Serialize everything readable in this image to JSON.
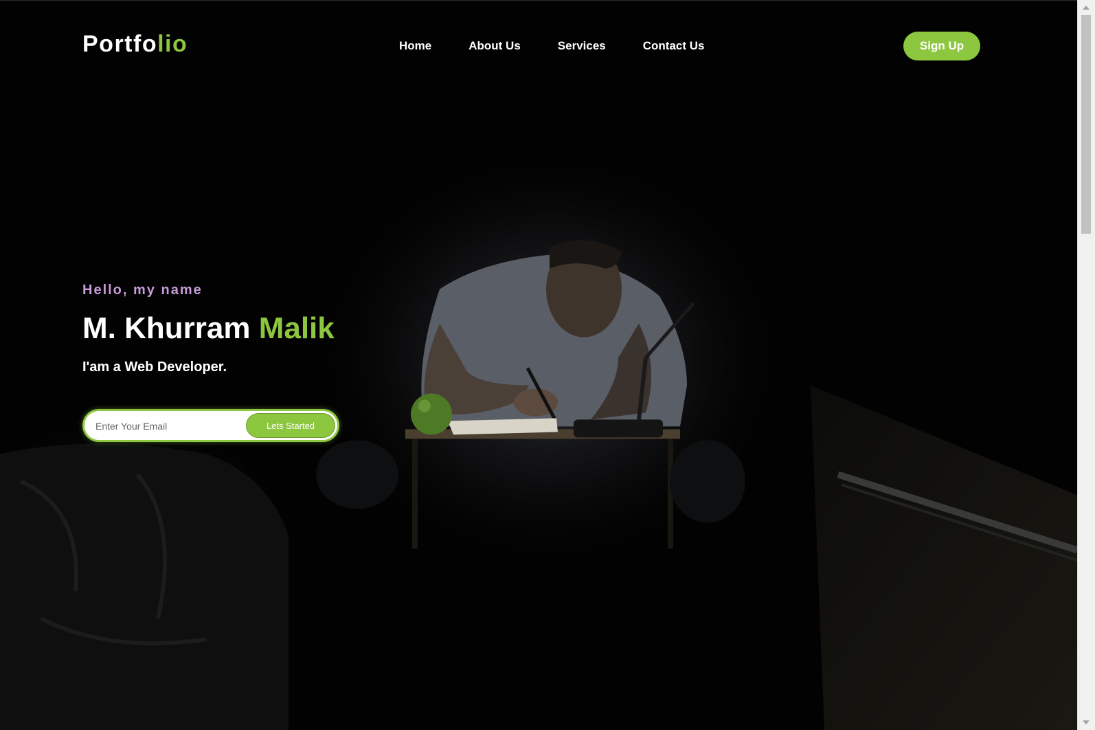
{
  "header": {
    "logo_main": "Portfo",
    "logo_accent": "lio",
    "nav": [
      {
        "label": "Home"
      },
      {
        "label": "About Us"
      },
      {
        "label": "Services"
      },
      {
        "label": "Contact Us"
      }
    ],
    "signup_label": "Sign Up"
  },
  "hero": {
    "greeting": "Hello, my name",
    "name_main": "M. Khurram ",
    "name_accent": "Malik",
    "role": "I'am a Web Developer.",
    "email_placeholder": "Enter Your Email",
    "cta_label": "Lets Started"
  },
  "colors": {
    "accent": "#8dc63f",
    "greeting": "#c79ad8",
    "background": "#020202",
    "text": "#ffffff"
  },
  "icons": [
    "scroll-up-arrow-icon",
    "scroll-down-arrow-icon"
  ]
}
